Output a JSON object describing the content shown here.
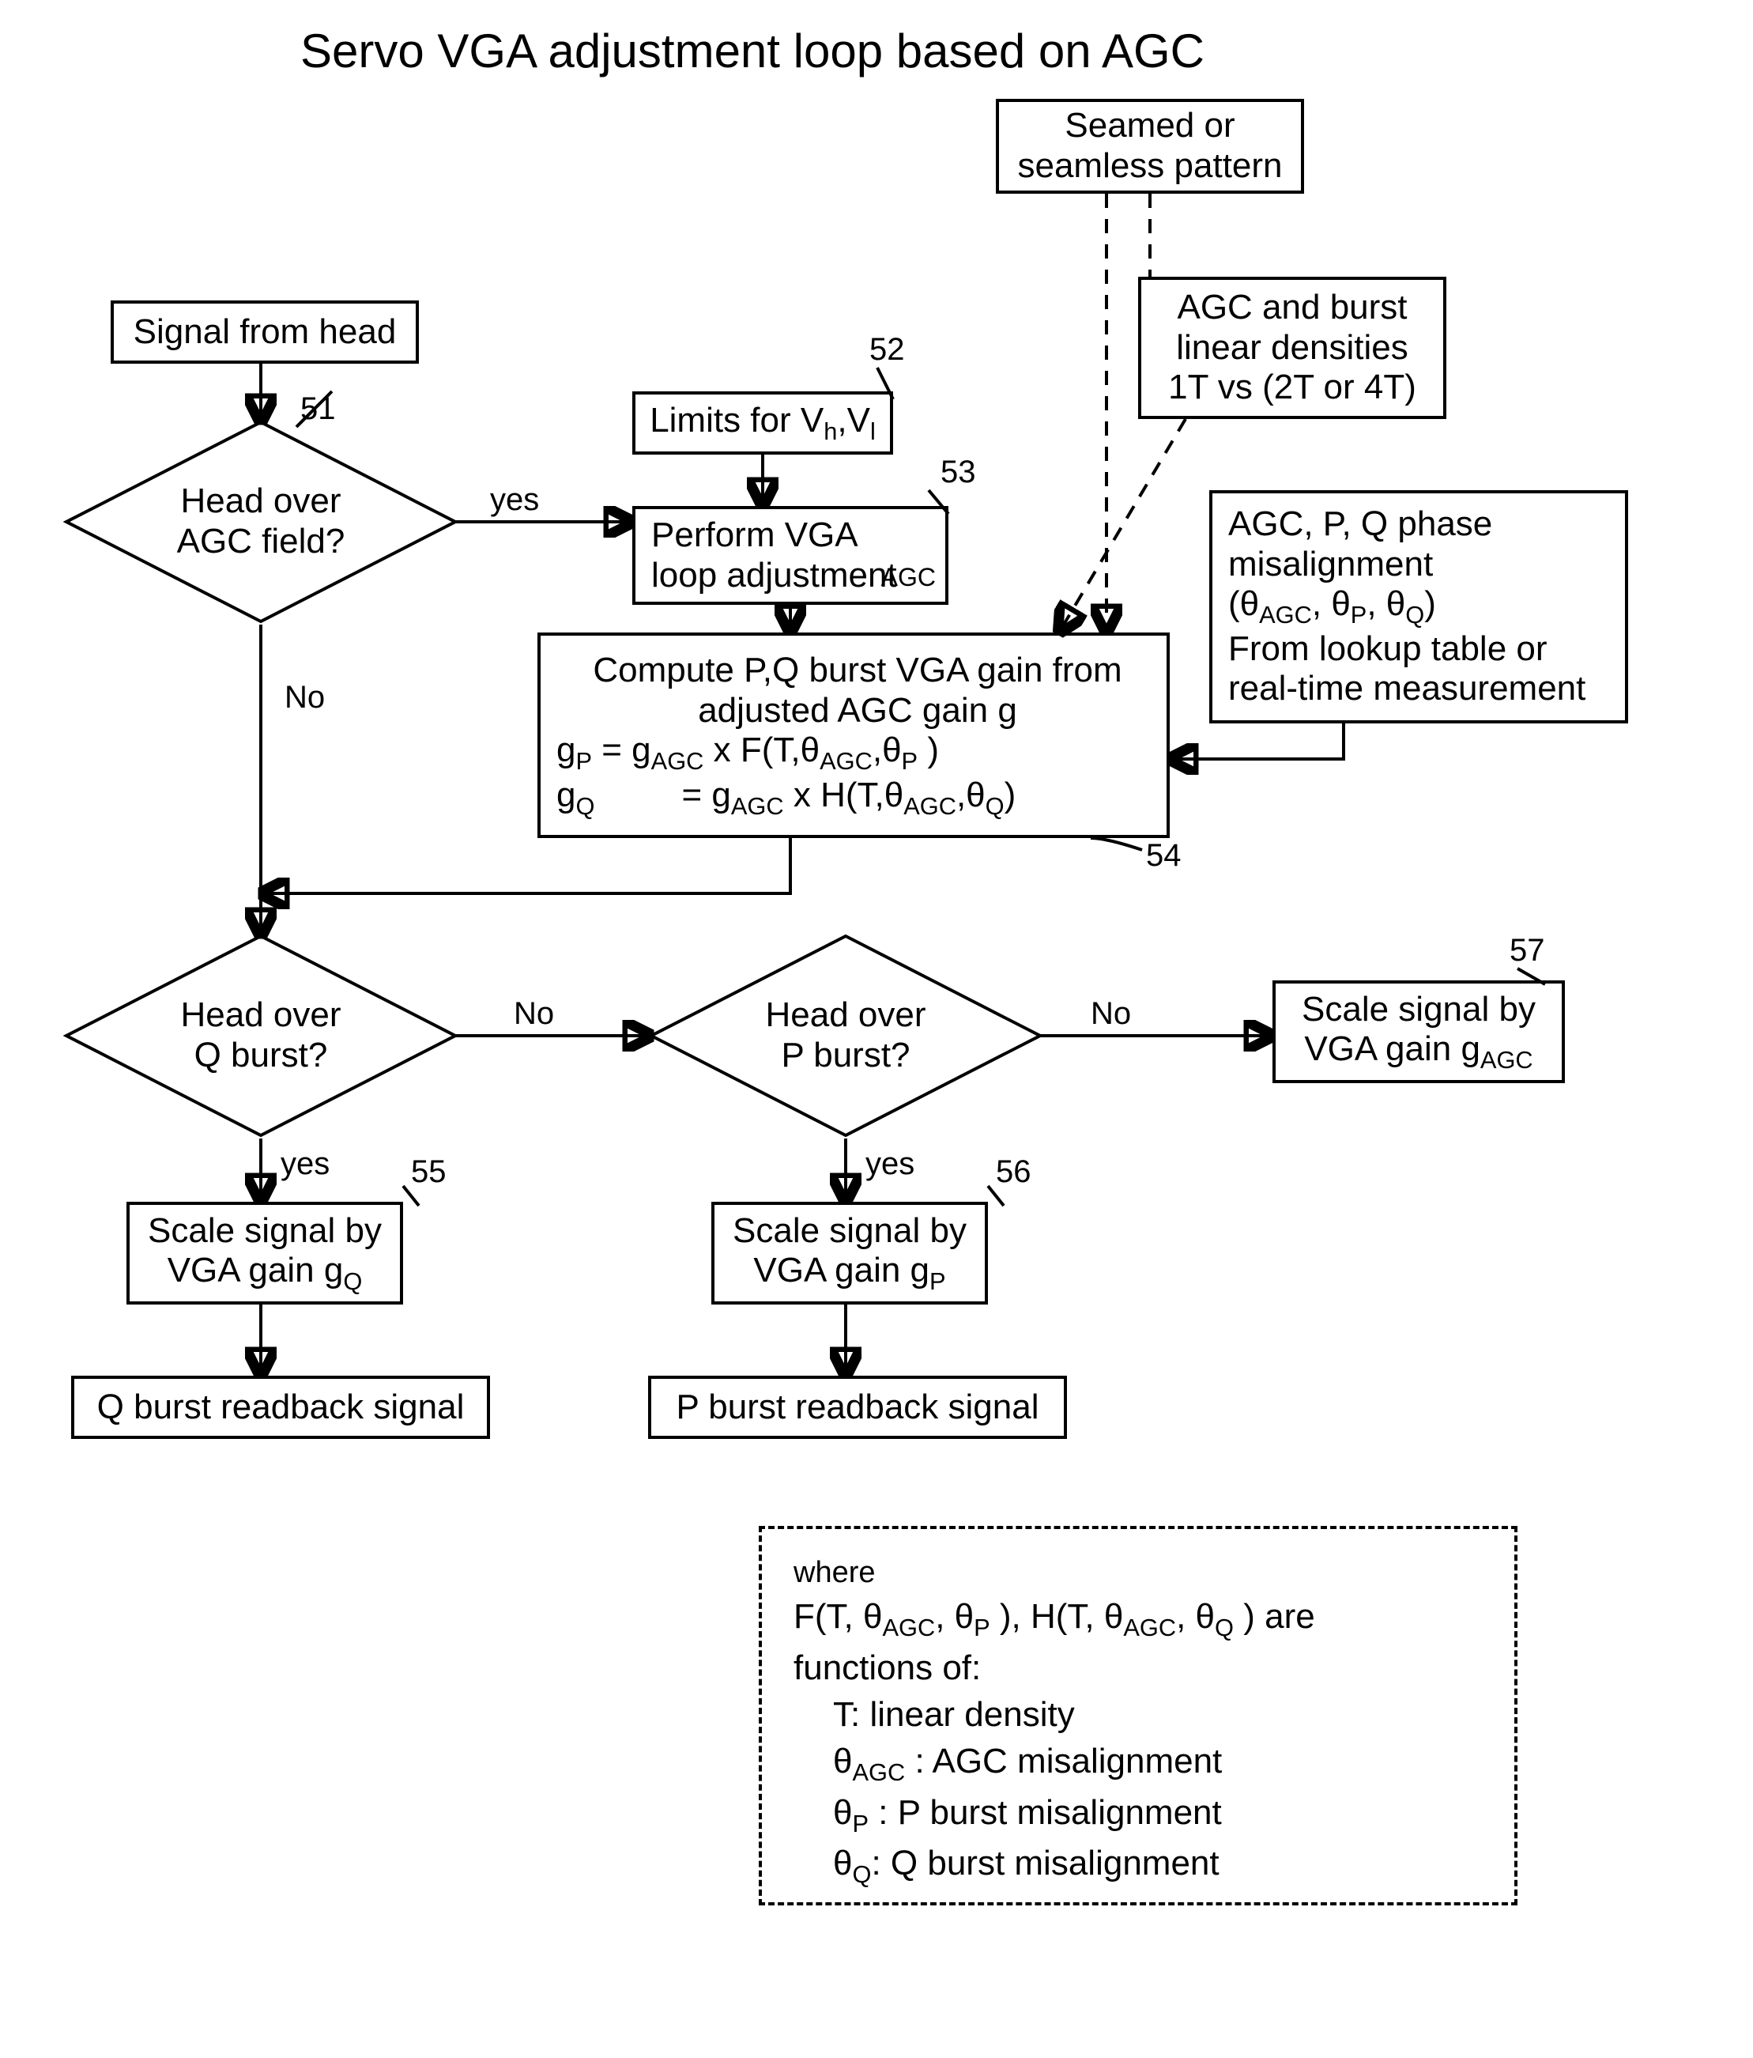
{
  "title": "Servo VGA adjustment loop based on AGC",
  "boxes": {
    "signal_head": "Signal from head",
    "limits": "Limits for V_h,V_l",
    "perform_vga": "Perform VGA\nloop adjustment",
    "agc_label": "AGC",
    "seamed": "Seamed or\nseamless pattern",
    "densities": "AGC and burst\nlinear densities\n1T vs (2T or 4T)",
    "misalign_l1": "AGC, P, Q phase",
    "misalign_l2": "misalignment",
    "misalign_l3": "(θ_AGC, θ_P, θ_Q)",
    "misalign_l4": "From lookup table or",
    "misalign_l5": "real-time measurement",
    "compute_l1": "Compute P,Q burst VGA gain from",
    "compute_l2": "adjusted AGC gain g",
    "compute_l3": "g_P = g_AGC x F(T,θ_AGC,θ_P )",
    "compute_l4": "g_Q        = g_AGC x H(T,θ_AGC,θ_Q)",
    "scale_gq": "Scale signal by\nVGA gain g_Q",
    "scale_gp": "Scale signal by\nVGA gain g_P",
    "scale_gagc": "Scale signal by\nVGA gain g_AGC",
    "q_readback": "Q burst readback signal",
    "p_readback": "P burst readback signal"
  },
  "decisions": {
    "agc_field": "Head over\nAGC field?",
    "q_burst": "Head over\nQ burst?",
    "p_burst": "Head over\nP burst?"
  },
  "labels": {
    "yes": "yes",
    "no": "No"
  },
  "refs": {
    "r51": "51",
    "r52": "52",
    "r53": "53",
    "r54": "54",
    "r55": "55",
    "r56": "56",
    "r57": "57"
  },
  "legend": {
    "where": "where",
    "l1": "F(T, θ_AGC, θ_P ), H(T, θ_AGC, θ_Q ) are",
    "l2": "functions of:",
    "l3": "T: linear density",
    "l4": "θ_AGC : AGC misalignment",
    "l5": "θ_P : P burst misalignment",
    "l6": "θ_Q: Q burst misalignment"
  },
  "chart_data": {
    "type": "flowchart",
    "nodes": [
      {
        "id": "start",
        "kind": "process",
        "label": "Signal from head"
      },
      {
        "id": "d_agc",
        "kind": "decision",
        "ref": 51,
        "label": "Head over AGC field?"
      },
      {
        "id": "limits",
        "kind": "process",
        "ref": 52,
        "label": "Limits for Vh, Vl"
      },
      {
        "id": "perform",
        "kind": "process",
        "ref": 53,
        "label": "Perform VGA loop adjustment",
        "tag": "AGC"
      },
      {
        "id": "compute",
        "kind": "process",
        "ref": 54,
        "label": "Compute P,Q burst VGA gain from adjusted AGC gain g; gP = gAGC × F(T, θAGC, θP); gQ = gAGC × H(T, θAGC, θQ)"
      },
      {
        "id": "d_q",
        "kind": "decision",
        "label": "Head over Q burst?"
      },
      {
        "id": "d_p",
        "kind": "decision",
        "label": "Head over P burst?"
      },
      {
        "id": "scale_q",
        "kind": "process",
        "ref": 55,
        "label": "Scale signal by VGA gain gQ"
      },
      {
        "id": "scale_p",
        "kind": "process",
        "ref": 56,
        "label": "Scale signal by VGA gain gP"
      },
      {
        "id": "scale_agc",
        "kind": "process",
        "ref": 57,
        "label": "Scale signal by VGA gain gAGC"
      },
      {
        "id": "out_q",
        "kind": "process",
        "label": "Q burst readback signal"
      },
      {
        "id": "out_p",
        "kind": "process",
        "label": "P burst readback signal"
      },
      {
        "id": "note_seam",
        "kind": "note",
        "label": "Seamed or seamless pattern"
      },
      {
        "id": "note_dens",
        "kind": "note",
        "label": "AGC and burst linear densities 1T vs (2T or 4T)"
      },
      {
        "id": "note_theta",
        "kind": "note",
        "label": "AGC, P, Q phase misalignment (θAGC, θP, θQ) From lookup table or real-time measurement"
      },
      {
        "id": "legend",
        "kind": "note",
        "label": "where F(T, θAGC, θP), H(T, θAGC, θQ) are functions of: T: linear density; θAGC: AGC misalignment; θP: P burst misalignment; θQ: Q burst misalignment"
      }
    ],
    "edges": [
      {
        "from": "start",
        "to": "d_agc"
      },
      {
        "from": "d_agc",
        "to": "perform",
        "label": "yes"
      },
      {
        "from": "d_agc",
        "to": "d_q",
        "label": "No"
      },
      {
        "from": "limits",
        "to": "perform"
      },
      {
        "from": "perform",
        "to": "compute"
      },
      {
        "from": "compute",
        "to": "d_q"
      },
      {
        "from": "d_q",
        "to": "scale_q",
        "label": "yes"
      },
      {
        "from": "d_q",
        "to": "d_p",
        "label": "No"
      },
      {
        "from": "d_p",
        "to": "scale_p",
        "label": "yes"
      },
      {
        "from": "d_p",
        "to": "scale_agc",
        "label": "No"
      },
      {
        "from": "scale_q",
        "to": "out_q"
      },
      {
        "from": "scale_p",
        "to": "out_p"
      },
      {
        "from": "note_seam",
        "to": "compute",
        "style": "dashed"
      },
      {
        "from": "note_dens",
        "to": "compute",
        "style": "dashed"
      },
      {
        "from": "note_theta",
        "to": "compute"
      }
    ]
  }
}
